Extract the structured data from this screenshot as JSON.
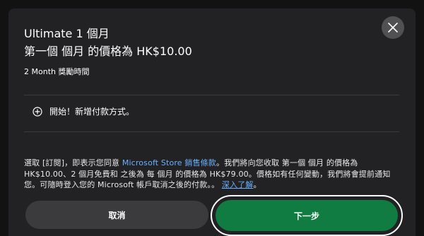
{
  "dialog": {
    "title": "Ultimate 1 個月",
    "price_line": "第一個 個月 的價格為 HK$10.00",
    "bonus_line": "2 Month 獎勵時間"
  },
  "payment": {
    "add_label": "開始！新增付款方式。",
    "icon": "plus-circle-icon"
  },
  "legal": {
    "part1": "選取 [訂閱]，即表示您同意 ",
    "terms_link": "Microsoft Store 銷售條款",
    "part2": "。我們將向您收取 第一個 個月 的價格為 HK$10.00、2 個月免費和 之後為 每 個月 的價格為 HK$79.00。價格如有任何變動，我們將會提前通知您。可隨時登入您的 Microsoft 帳戶取消之後的付款。",
    "part3": "。",
    "learn_more_link": "深入了解",
    "part4": "。"
  },
  "buttons": {
    "cancel_label": "取消",
    "next_label": "下一步"
  },
  "colors": {
    "dialog_bg": "#222224",
    "accent_green": "#107c41",
    "link_blue": "#6bb0ff",
    "secondary_button": "#3b3b3d"
  }
}
